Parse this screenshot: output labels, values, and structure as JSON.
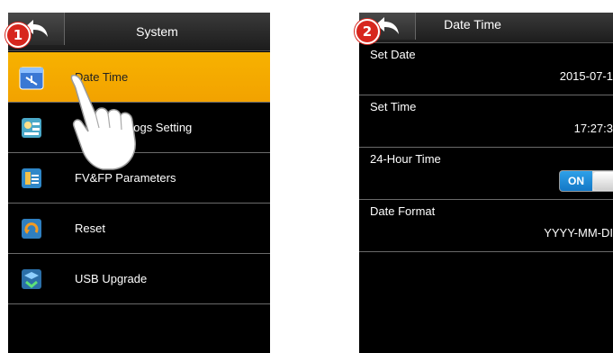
{
  "steps": {
    "one": "1",
    "two": "2"
  },
  "screen1": {
    "title": "System",
    "menu": [
      {
        "label": "Date Time",
        "icon": "calendar-clock-icon",
        "selected": true
      },
      {
        "label": "Logs Setting",
        "icon": "logs-icon"
      },
      {
        "label": "FV&FP Parameters",
        "icon": "parameters-icon"
      },
      {
        "label": "Reset",
        "icon": "reset-icon"
      },
      {
        "label": "USB Upgrade",
        "icon": "usb-upgrade-icon"
      }
    ]
  },
  "screen2": {
    "title": "Date Time",
    "settings": {
      "set_date": {
        "label": "Set Date",
        "value": "2015-07-1"
      },
      "set_time": {
        "label": "Set Time",
        "value": "17:27:3"
      },
      "hour24": {
        "label": "24-Hour Time",
        "toggle": "ON"
      },
      "date_format": {
        "label": "Date Format",
        "value": "YYYY-MM-DI"
      }
    }
  },
  "colors": {
    "selected": "#f5a800",
    "badge": "#d7261d",
    "toggle_on": "#1f8ad8"
  }
}
